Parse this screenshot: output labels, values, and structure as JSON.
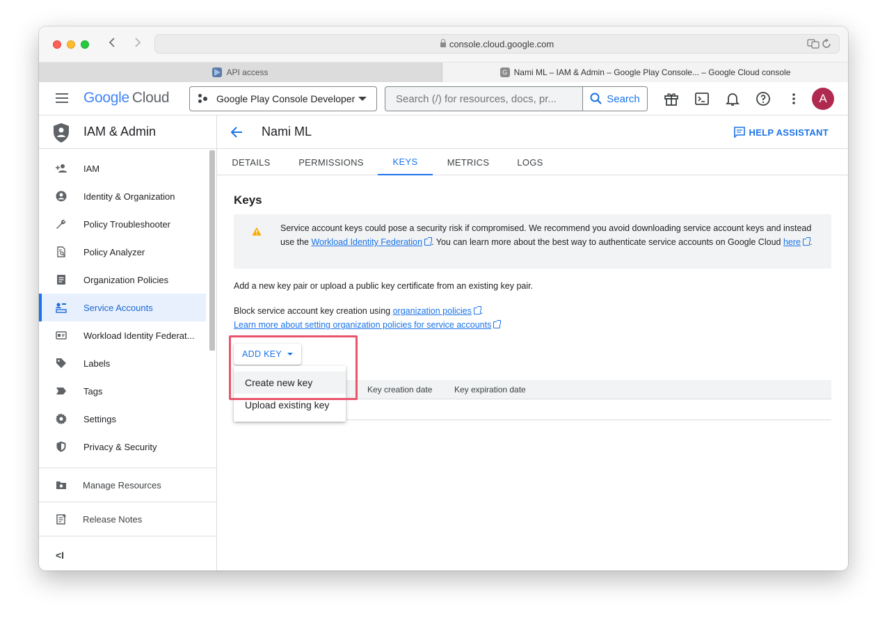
{
  "browser": {
    "url": "console.cloud.google.com",
    "tabs": [
      {
        "label": "API access"
      },
      {
        "label": "Nami ML – IAM & Admin – Google Play Console... – Google Cloud console",
        "favicon": "G"
      }
    ]
  },
  "header": {
    "logo_google": "Google",
    "logo_cloud": "Cloud",
    "project": "Google Play Console Developer",
    "search_placeholder": "Search (/) for resources, docs, pr...",
    "search_button": "Search",
    "avatar_initial": "A",
    "icons": [
      "gift-icon",
      "cloud-shell-icon",
      "notifications-icon",
      "help-icon",
      "more-vert-icon"
    ]
  },
  "sidebar": {
    "title": "IAM & Admin",
    "items": [
      {
        "label": "IAM",
        "icon": "person-add-icon"
      },
      {
        "label": "Identity & Organization",
        "icon": "account-circle-icon"
      },
      {
        "label": "Policy Troubleshooter",
        "icon": "wrench-icon"
      },
      {
        "label": "Policy Analyzer",
        "icon": "policy-analyzer-icon"
      },
      {
        "label": "Organization Policies",
        "icon": "document-icon"
      },
      {
        "label": "Service Accounts",
        "icon": "service-account-icon",
        "active": true
      },
      {
        "label": "Workload Identity Federat...",
        "icon": "badge-icon"
      },
      {
        "label": "Labels",
        "icon": "label-icon"
      },
      {
        "label": "Tags",
        "icon": "tag-icon"
      },
      {
        "label": "Settings",
        "icon": "gear-icon"
      },
      {
        "label": "Privacy & Security",
        "icon": "shield-icon"
      }
    ],
    "manage_resources": "Manage Resources",
    "release_notes": "Release Notes",
    "collapse": "<I"
  },
  "main": {
    "title": "Nami ML",
    "help_assistant": "HELP ASSISTANT",
    "tabs": [
      {
        "label": "DETAILS"
      },
      {
        "label": "PERMISSIONS"
      },
      {
        "label": "KEYS",
        "active": true
      },
      {
        "label": "METRICS"
      },
      {
        "label": "LOGS"
      }
    ],
    "section_title": "Keys",
    "warning": {
      "part1": "Service account keys could pose a security risk if compromised. We recommend you avoid downloading service account keys and instead use the ",
      "link1": "Workload Identity Federation",
      "part2": ". You can learn more about the best way to authenticate service accounts on Google Cloud ",
      "link2": "here",
      "part3": "."
    },
    "add_key_text": "Add a new key pair or upload a public key certificate from an existing key pair.",
    "block_text": "Block service account key creation using ",
    "block_link": "organization policies",
    "block_end": ".",
    "learn_more_link": "Learn more about setting organization policies for service accounts",
    "add_key_button": "ADD KEY",
    "table_headers": [
      "Key creation date",
      "Key expiration date"
    ],
    "menu": [
      {
        "label": "Create new key",
        "highlighted": true
      },
      {
        "label": "Upload existing key"
      }
    ]
  }
}
